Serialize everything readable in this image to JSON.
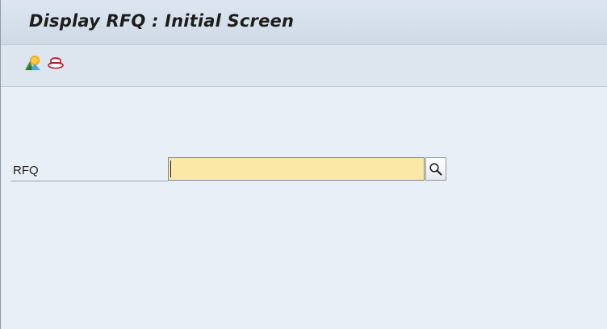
{
  "header": {
    "title": "Display RFQ : Initial Screen"
  },
  "toolbar": {
    "buttons": [
      {
        "icon": "landscape-sun-icon",
        "tooltip": ""
      },
      {
        "icon": "hat-icon",
        "tooltip": ""
      }
    ]
  },
  "form": {
    "rfq": {
      "label": "RFQ",
      "value": "",
      "placeholder": ""
    },
    "search_help_icon": "magnifier-icon"
  },
  "colors": {
    "background": "#e9eff6",
    "title_bar": "#d6e0eb",
    "input_fill": "#fce8a6",
    "toolbar": "#dde5ee"
  }
}
